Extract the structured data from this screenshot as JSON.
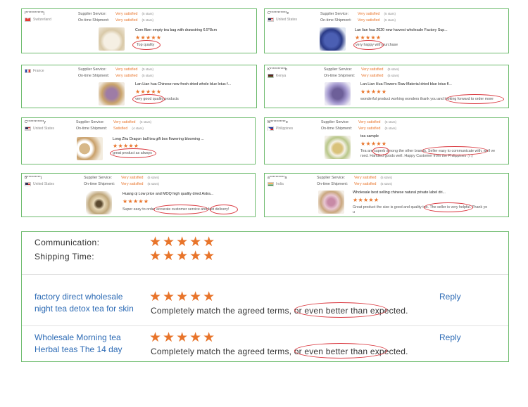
{
  "metric_labels": {
    "supplier_service": "Supplier Service:",
    "shipment": "On-time Shipment:"
  },
  "reviews": [
    {
      "buyer": "l************j",
      "flag": "switzerland-flag",
      "country": "Switzerland",
      "service": "Very satisfied",
      "service_stars": "(5 stars)",
      "shipment": "Very satisfied",
      "shipment_stars": "(5 stars)",
      "title": "Corn fiber empty tea bag with drawstring 6.5*8cm",
      "stars": "★★★★★",
      "comment": "Top quality"
    },
    {
      "buyer": "C***********e",
      "flag": "united-states-flag",
      "country": "United States",
      "service": "Very satisfied",
      "service_stars": "(5 stars)",
      "shipment": "Very satisfied",
      "shipment_stars": "(5 stars)",
      "title": "Lan lian hua 2020 new harvest wholesale Factory Sup...",
      "stars": "★★★★★",
      "comment": "very happy with purchase"
    },
    {
      "buyer": "",
      "flag": "france-flag",
      "country": "France",
      "service": "Very satisfied",
      "service_stars": "(5 stars)",
      "shipment": "Very satisfied",
      "shipment_stars": "(5 stars)",
      "title": "Lan Lian hua Chinese new fresh dried whole blue lotus f...",
      "stars": "★★★★★",
      "comment": "very good quality products"
    },
    {
      "buyer": "K**********b",
      "flag": "kenya-flag",
      "country": "Kenya",
      "service": "Very satisfied",
      "service_stars": "(5 stars)",
      "shipment": "Very satisfied",
      "shipment_stars": "(5 stars)",
      "title": "Lan Lian Hua Flowers Raw Material dried blue lotus fl...",
      "stars": "★★★★★",
      "comment": "wonderful product working wonders thank you and looking forward to order more"
    },
    {
      "buyer": "C***********y",
      "flag": "united-states-flag",
      "country": "United States",
      "service": "Very satisfied",
      "service_stars": "(5 stars)",
      "shipment": "Satisfied",
      "shipment_stars": "(4 stars)",
      "title": "Long Zhu Dragon ball tea gift box flowering blooming ...",
      "stars": "★★★★★",
      "comment": "great product as always"
    },
    {
      "buyer": "M**********o",
      "flag": "philippines-flag",
      "country": "Philippines",
      "service": "Very satisfied",
      "service_stars": "(5 stars)",
      "shipment": "Very satisfied",
      "shipment_stars": "(5 stars)",
      "title": "tea sample",
      "stars": "★★★★★",
      "comment_line1": "Tea are superb among the other brands. Seller easy to communicate with, well ve",
      "comment_line2": "rsed. Handled goods well. Happy Customer from the Philippines :) :)"
    },
    {
      "buyer": "B*********j",
      "flag": "united-states-flag",
      "country": "United States",
      "service": "Very satisfied",
      "service_stars": "(5 stars)",
      "shipment": "Very satisfied",
      "shipment_stars": "(5 stars)",
      "title": "Huang qi Low price and MOQ high quality dried Astra...",
      "stars": "★★★★★",
      "comment": "Super easy to order accurate customer service and fast delivery!"
    },
    {
      "buyer": "a**********a",
      "flag": "india-flag",
      "country": "India",
      "service": "Very satisfied",
      "service_stars": "(5 stars)",
      "shipment": "Very satisfied",
      "shipment_stars": "(5 stars)",
      "title": "Wholesale best selling chinese natural private label dri...",
      "stars": "★★★★★",
      "comment_line1": "Great product the size is good and quality too. The seller is very helpful. Thank yo",
      "comment_line2": "u"
    }
  ],
  "summary": {
    "communication_label": "Communication:",
    "shipping_label": "Shipping Time:",
    "stars": "★★★★★"
  },
  "product_reviews": [
    {
      "link": "factory direct wholesale night tea detox tea for skin",
      "stars": "★★★★★",
      "text": "Completely match the agreed terms, or even better than expected.",
      "reply": "Reply"
    },
    {
      "link": "Wholesale Morning tea Herbal teas The 14 day",
      "stars": "★★★★★",
      "text": "Completely match the agreed terms, or even better than expected.",
      "reply": "Reply"
    }
  ],
  "colors": {
    "accent": "#e8742a",
    "link": "#2d6bb5",
    "border": "#6dbb6d",
    "highlight": "#d9343b"
  }
}
